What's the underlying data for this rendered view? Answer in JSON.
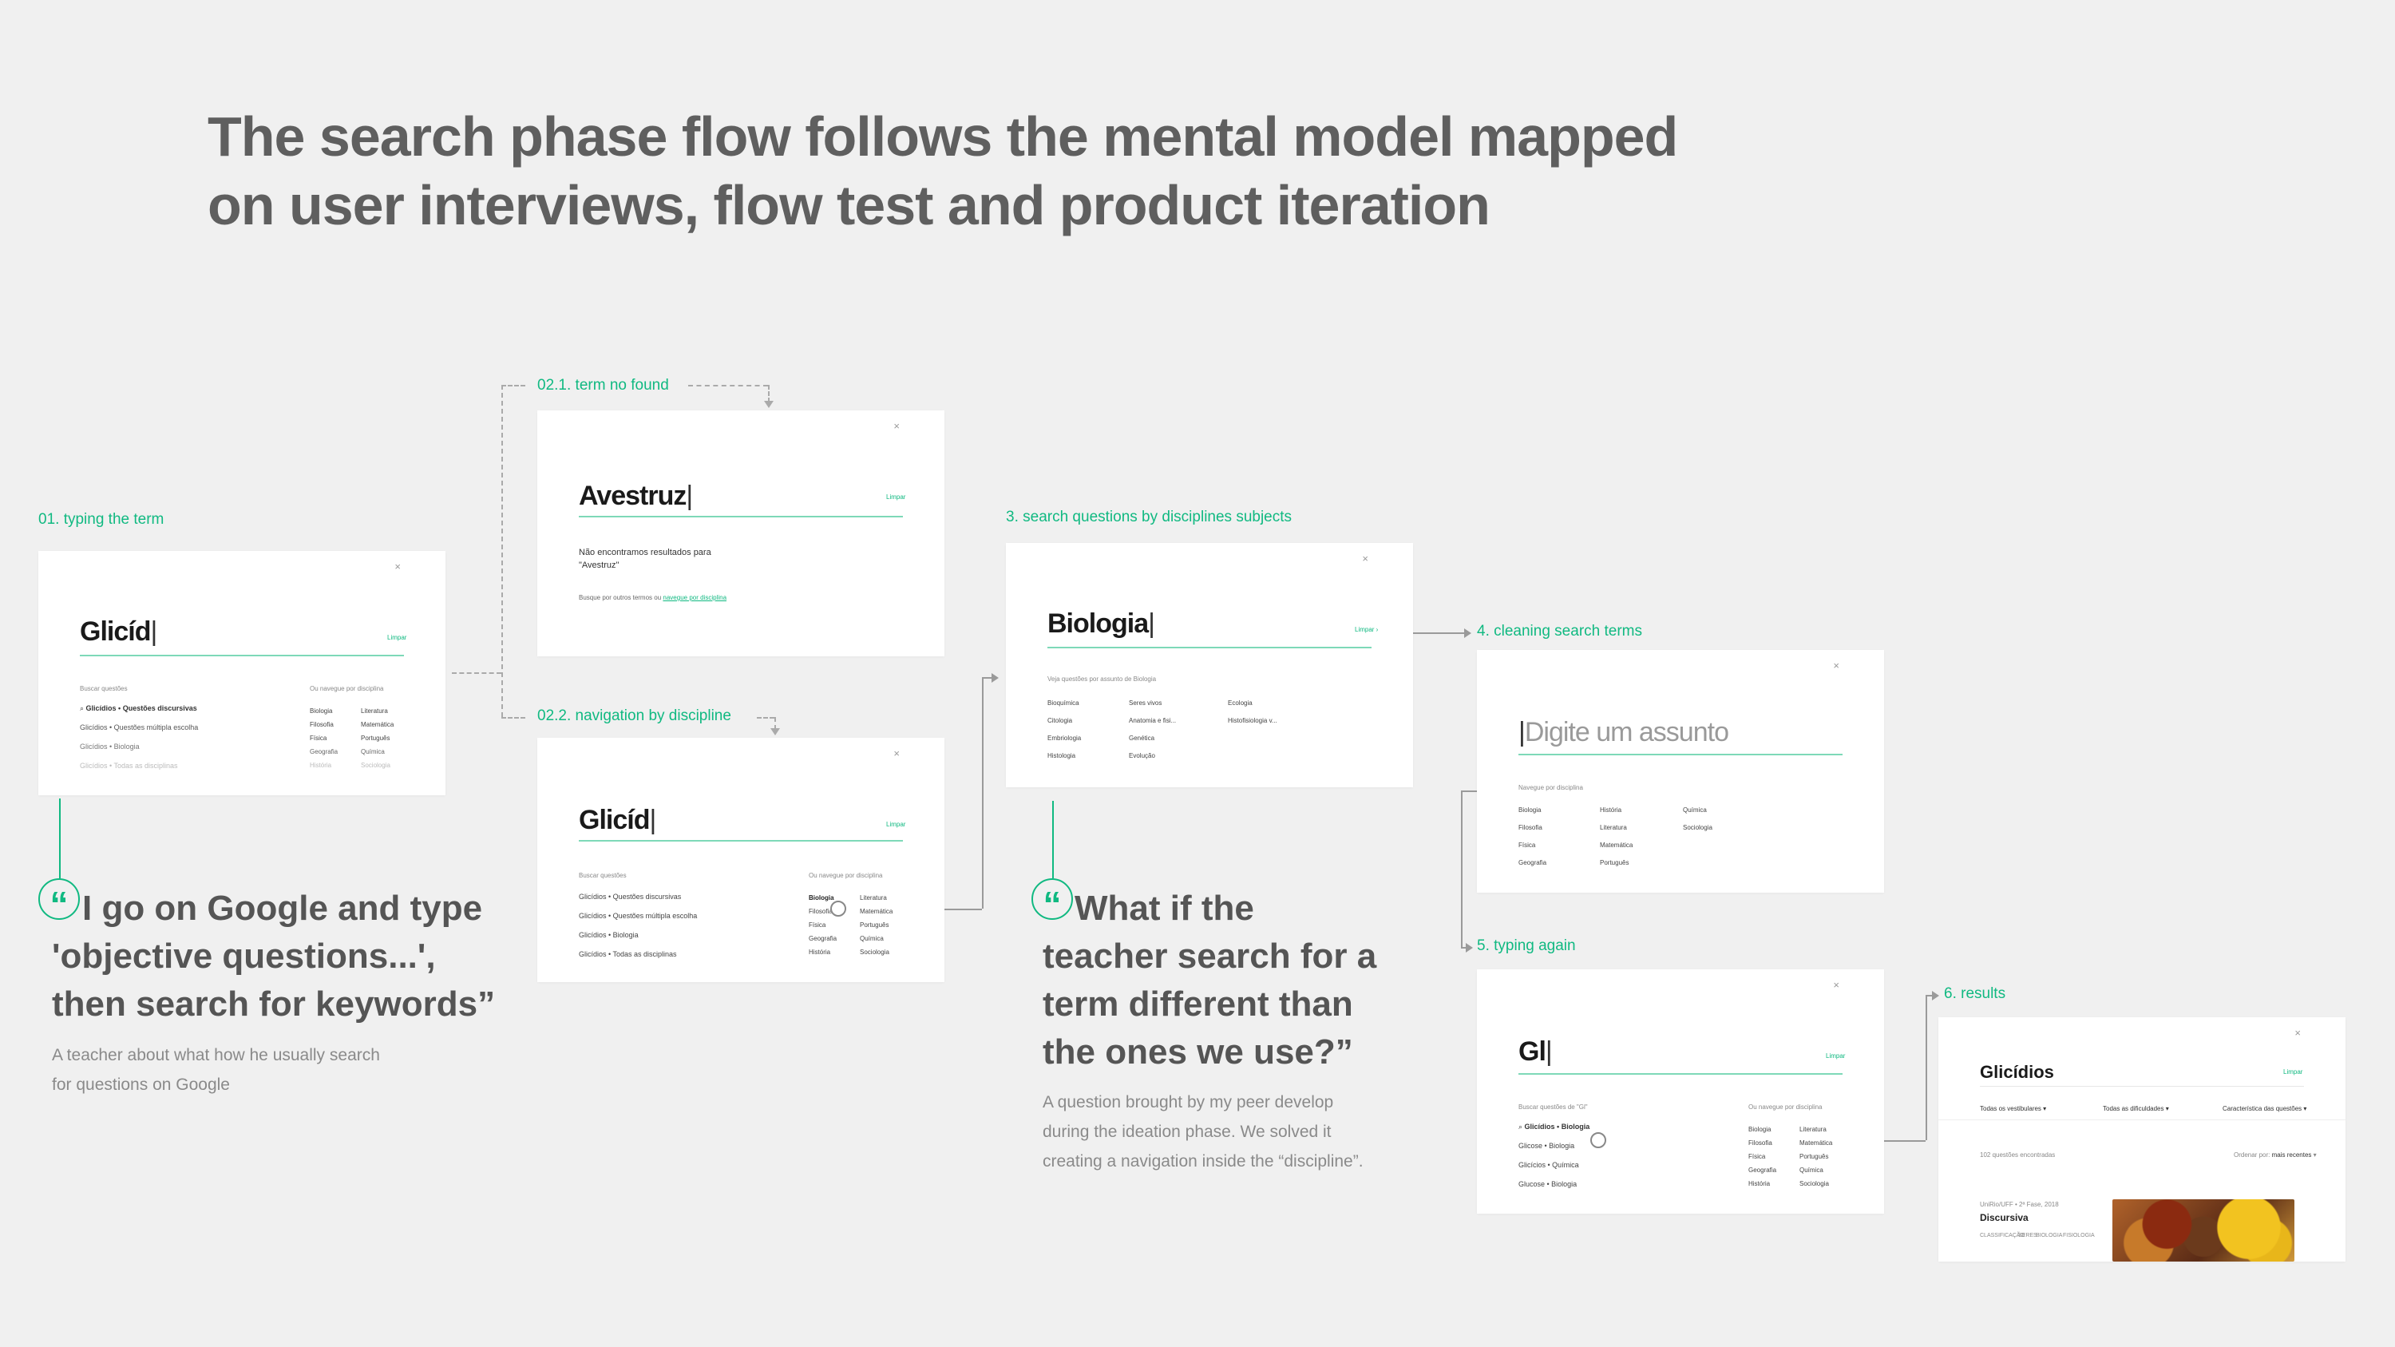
{
  "title": {
    "line1": "The search phase flow follows the mental model mapped",
    "line2": "on user interviews, flow test and product iteration"
  },
  "steps": {
    "s01": "01. typing the term",
    "s021": "02.1. term no found",
    "s022": "02.2. navigation by discipline",
    "s3": "3. search questions by disciplines subjects",
    "s4": "4. cleaning search terms",
    "s5": "5. typing again",
    "s6": "6. results"
  },
  "common": {
    "limpar": "Limpar",
    "close": "×"
  },
  "card1": {
    "term": "Glicíd",
    "left_header": "Buscar questões",
    "suggestions": [
      "Glicídios • Questões discursivas",
      "Glicídios • Questões múltipla escolha",
      "Glicídios • Biologia",
      "Glicídios • Todas as disciplinas"
    ],
    "right_header": "Ou navegue por disciplina",
    "col1": [
      "Biologia",
      "Filosofia",
      "Física",
      "Geografia",
      "História"
    ],
    "col2": [
      "Literatura",
      "Matemática",
      "Português",
      "Química",
      "Sociologia"
    ]
  },
  "card21": {
    "term": "Avestruz",
    "no_result": "Não encontramos resultados para",
    "no_result_term": "\"Avestruz\"",
    "hint": "Busque por outros termos ou",
    "hint_link": "navegue por disciplina"
  },
  "card22": {
    "term": "Glicíd",
    "left_header": "Buscar questões",
    "suggestions": [
      "Glicídios • Questões discursivas",
      "Glicídios • Questões múltipla escolha",
      "Glicídios • Biologia",
      "Glicídios • Todas as disciplinas"
    ],
    "right_header": "Ou navegue por disciplina",
    "col1": [
      "Biologia",
      "Filosofia",
      "Física",
      "Geografia",
      "História"
    ],
    "col2": [
      "Literatura",
      "Matemática",
      "Português",
      "Química",
      "Sociologia"
    ]
  },
  "card3": {
    "term": "Biologia",
    "header": "Veja questões por assunto de Biologia",
    "col1": [
      "Bioquímica",
      "Citologia",
      "Embriologia",
      "Histologia"
    ],
    "col2": [
      "Seres vivos",
      "Anatomia e fisi...",
      "Genética",
      "Evolução"
    ],
    "col3": [
      "Ecologia",
      "Histofisiologia v..."
    ]
  },
  "card4": {
    "placeholder": "Digite um assunto",
    "header": "Navegue por disciplina",
    "col1": [
      "Biologia",
      "Filosofia",
      "Física",
      "Geografia"
    ],
    "col2": [
      "História",
      "Literatura",
      "Matemática",
      "Português"
    ],
    "col3": [
      "Química",
      "Sociologia"
    ]
  },
  "card5": {
    "term": "Gl",
    "left_header": "Buscar questões de \"Gl\"",
    "suggestions": [
      "Glicídios • Biologia",
      "Glicose • Biologia",
      "Glicícios • Química",
      "Glucose • Biologia"
    ],
    "right_header": "Ou navegue por disciplina",
    "col1": [
      "Biologia",
      "Filosofia",
      "Física",
      "Geografia",
      "História"
    ],
    "col2": [
      "Literatura",
      "Matemática",
      "Português",
      "Química",
      "Sociologia"
    ]
  },
  "card6": {
    "term": "Glicídios",
    "filters": [
      "Todas os vestibulares",
      "Todas as dificuldades",
      "Característica das questões"
    ],
    "count": "102 questões encontradas",
    "sort_label": "Ordenar por:",
    "sort_value": "mais recentes",
    "meta": "UniRio/UFF • 2ª Fase, 2018",
    "type": "Discursiva",
    "tags": [
      "CLASSIFICAÇÃO",
      "SERES",
      "BIOLOGIA",
      "FISIOLOGIA"
    ]
  },
  "quote1": {
    "mark": "“",
    "text_line1": "I go on Google and type",
    "text_line2": "'objective questions...',",
    "text_line3": "then search for keywords”",
    "caption_line1": "A teacher about what how he usually search",
    "caption_line2": "for questions on Google"
  },
  "quote2": {
    "mark": "“",
    "text_line1": "What if the",
    "text_line2": "teacher search for a",
    "text_line3": "term different than",
    "text_line4": "the ones we use?”",
    "caption_line1": "A question brought by my peer develop",
    "caption_line2": "during the ideation phase. We solved it",
    "caption_line3": "creating a navigation inside the “discipline”."
  },
  "colors": {
    "accent": "#10b981",
    "title": "#5f5f5f",
    "background": "#f0f0f0"
  }
}
